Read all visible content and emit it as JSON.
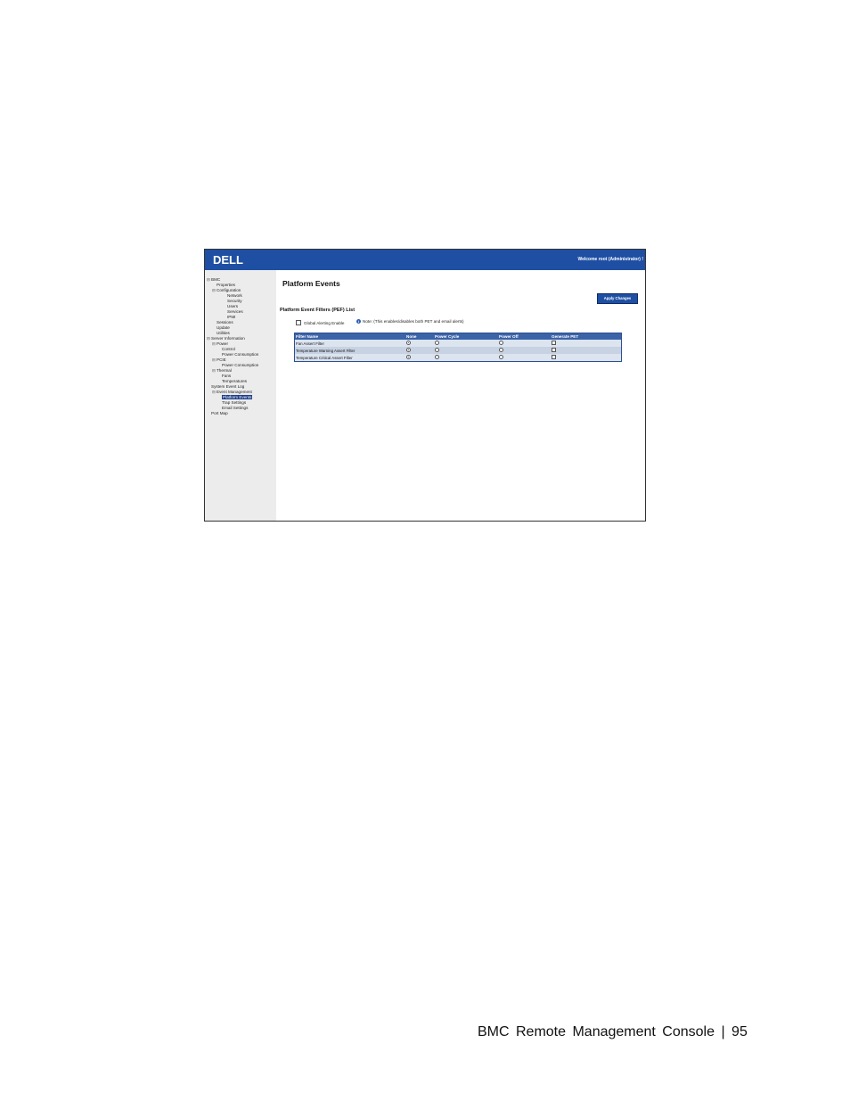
{
  "header": {
    "logo": "DELL",
    "welcome": "Welcome root (Administrator) !"
  },
  "sidebar": {
    "items": [
      {
        "label": "BMC",
        "indent": 0,
        "expander": "⊟"
      },
      {
        "label": "Properties",
        "indent": 1,
        "expander": ""
      },
      {
        "label": "Configuration",
        "indent": 1,
        "expander": "⊟"
      },
      {
        "label": "Network",
        "indent": 3,
        "expander": ""
      },
      {
        "label": "Security",
        "indent": 3,
        "expander": ""
      },
      {
        "label": "Users",
        "indent": 3,
        "expander": ""
      },
      {
        "label": "Services",
        "indent": 3,
        "expander": ""
      },
      {
        "label": "IPMI",
        "indent": 3,
        "expander": ""
      },
      {
        "label": "Sessions",
        "indent": 1,
        "expander": ""
      },
      {
        "label": "Update",
        "indent": 1,
        "expander": ""
      },
      {
        "label": "Utilities",
        "indent": 1,
        "expander": ""
      },
      {
        "label": "Server Information",
        "indent": 0,
        "expander": "⊟"
      },
      {
        "label": "Power",
        "indent": 1,
        "expander": "⊟"
      },
      {
        "label": "Control",
        "indent": 2,
        "expander": ""
      },
      {
        "label": "Power Consumption",
        "indent": 2,
        "expander": ""
      },
      {
        "label": "PCIE",
        "indent": 1,
        "expander": "⊟"
      },
      {
        "label": "Power Consumption",
        "indent": 2,
        "expander": ""
      },
      {
        "label": "Thermal",
        "indent": 1,
        "expander": "⊟"
      },
      {
        "label": "Fans",
        "indent": 2,
        "expander": ""
      },
      {
        "label": "Temperatures",
        "indent": 2,
        "expander": ""
      },
      {
        "label": "System Event Log",
        "indent": 0,
        "expander": ""
      },
      {
        "label": "Event Management",
        "indent": 1,
        "expander": "⊟"
      },
      {
        "label": "Platform Events",
        "indent": 2,
        "expander": "",
        "selected": true
      },
      {
        "label": "Trap Settings",
        "indent": 2,
        "expander": ""
      },
      {
        "label": "Email Settings",
        "indent": 2,
        "expander": ""
      },
      {
        "label": "Port Map",
        "indent": 0,
        "expander": ""
      }
    ]
  },
  "main": {
    "title": "Platform Events",
    "apply_label": "Apply Changes",
    "section_title": "Platform Event Filters (PEF) List",
    "global_label": "Global Alerting Enable",
    "note": "Note: (This enables/disables both PET and email alerts)",
    "table": {
      "columns": [
        "Filter Name",
        "None",
        "Power Cycle",
        "Power Off",
        "Generate PET"
      ],
      "rows": [
        {
          "name": "Fan Assert Filter",
          "selected": "None",
          "pet": false
        },
        {
          "name": "Temperature Warning Assert Filter",
          "selected": "None",
          "pet": false
        },
        {
          "name": "Temperature Critical Assert Filter",
          "selected": "None",
          "pet": false
        }
      ]
    }
  },
  "footer": {
    "text": "BMC Remote Management Console | 95"
  }
}
